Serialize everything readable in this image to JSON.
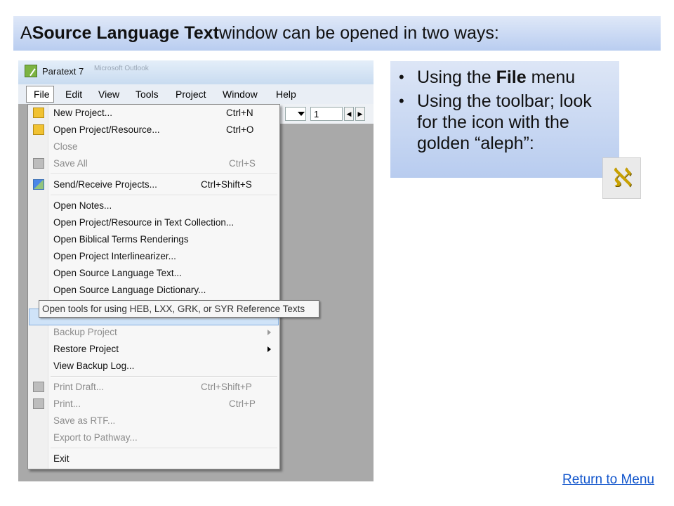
{
  "title": {
    "prefix": "A ",
    "bold": "Source Language Text",
    "suffix": " window can be opened in two ways:"
  },
  "app": {
    "title": "Paratext 7",
    "ghost_title": "Microsoft Outlook"
  },
  "menubar": [
    "File",
    "Edit",
    "View",
    "Tools",
    "Project",
    "Window",
    "Help"
  ],
  "toolbar": {
    "chapter_value": "1"
  },
  "file_menu": {
    "items": [
      {
        "label": "New Project...",
        "shortcut": "Ctrl+N"
      },
      {
        "label": "Open Project/Resource...",
        "shortcut": "Ctrl+O"
      },
      {
        "label": "Close",
        "shortcut": ""
      },
      {
        "label": "Save All",
        "shortcut": "Ctrl+S"
      },
      {
        "label": "Send/Receive Projects...",
        "shortcut": "Ctrl+Shift+S"
      },
      {
        "label": "Open Notes...",
        "shortcut": ""
      },
      {
        "label": "Open Project/Resource in Text Collection...",
        "shortcut": ""
      },
      {
        "label": "Open Biblical Terms Renderings",
        "shortcut": ""
      },
      {
        "label": "Open Project Interlinearizer...",
        "shortcut": ""
      },
      {
        "label": "Open Source Language Text...",
        "shortcut": ""
      },
      {
        "label": "Open Source Language Dictionary...",
        "shortcut": ""
      },
      {
        "label": "Backup Project",
        "shortcut": ""
      },
      {
        "label": "Restore Project",
        "shortcut": ""
      },
      {
        "label": "View Backup Log...",
        "shortcut": ""
      },
      {
        "label": "Print Draft...",
        "shortcut": "Ctrl+Shift+P"
      },
      {
        "label": "Print...",
        "shortcut": "Ctrl+P"
      },
      {
        "label": "Save as RTF...",
        "shortcut": ""
      },
      {
        "label": "Export to Pathway...",
        "shortcut": ""
      },
      {
        "label": "Exit",
        "shortcut": ""
      }
    ]
  },
  "tooltip": "Open tools for using HEB, LXX, GRK, or SYR Reference Texts",
  "bullets": {
    "b1_prefix": "Using the ",
    "b1_bold": "File",
    "b1_suffix": " menu",
    "b2": "Using the toolbar; look for the icon with the golden “aleph”:"
  },
  "aleph_glyph": "ℵ",
  "return_link": "Return to Menu",
  "colors": {
    "banner": "#b9cdf0",
    "highlight": "#cfe3f8",
    "link": "#1155cc"
  }
}
